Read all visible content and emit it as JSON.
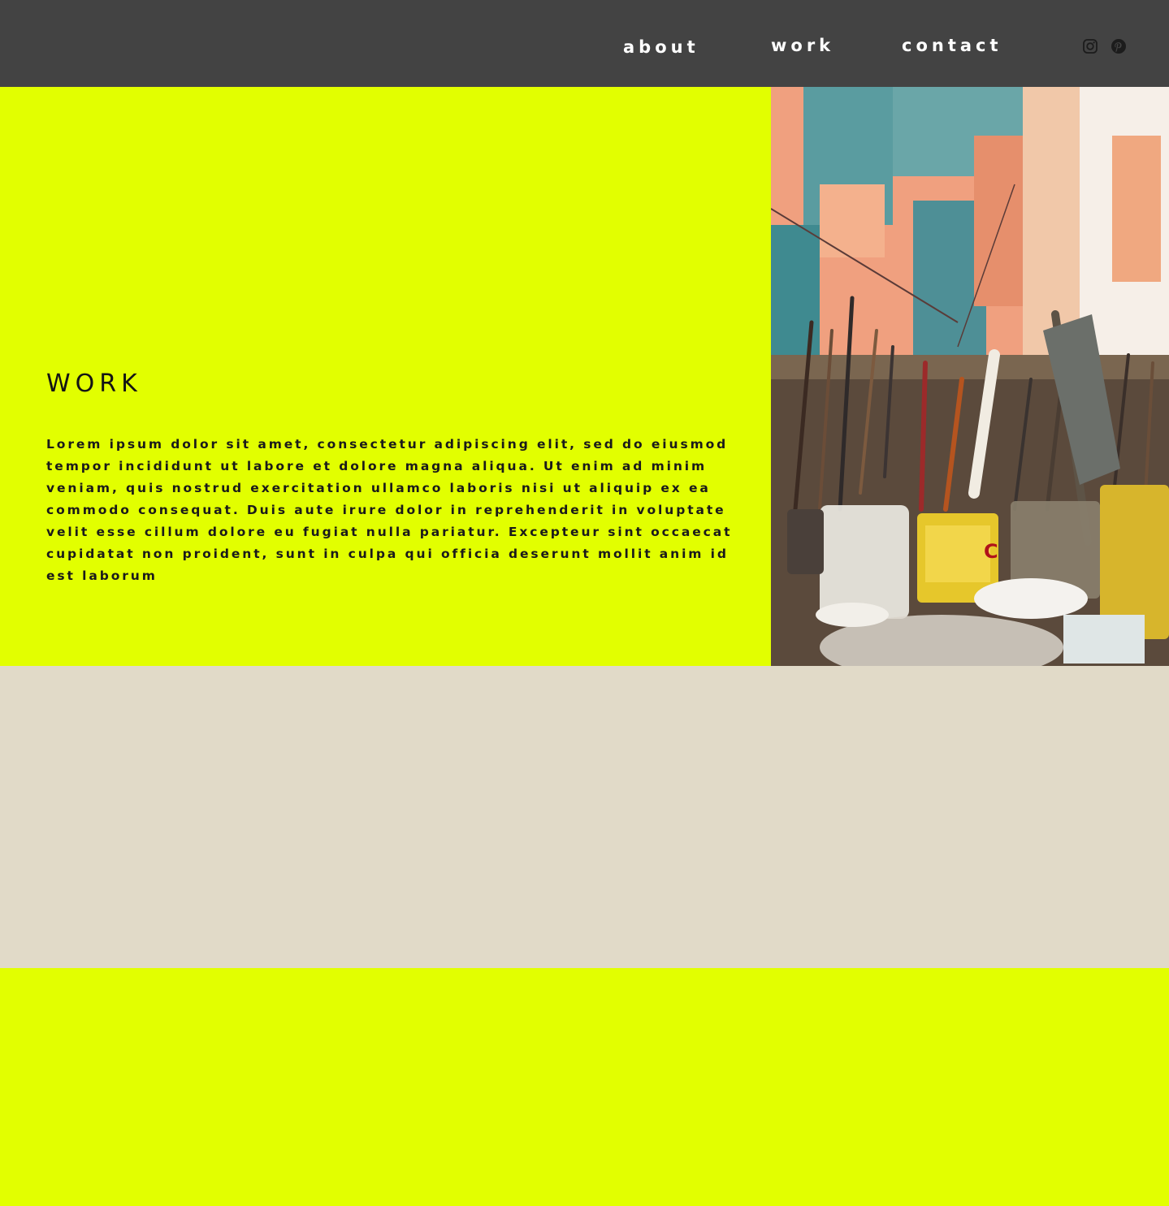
{
  "nav": {
    "links": [
      {
        "label": "about"
      },
      {
        "label": "work"
      },
      {
        "label": "contact"
      }
    ],
    "social": [
      {
        "icon": "instagram-icon"
      },
      {
        "icon": "pinterest-icon"
      }
    ]
  },
  "hero": {
    "title": "WORK",
    "body": "Lorem ipsum dolor sit amet, consectetur adipiscing elit, sed do eiusmod tempor incididunt ut labore et dolore magna aliqua. Ut enim ad minim veniam, quis nostrud exercitation ullamco laboris nisi ut aliquip ex ea commodo consequat. Duis aute irure dolor in reprehenderit in voluptate velit esse cillum dolore eu fugiat nulla pariatur. Excepteur sint occaecat cupidatat non proident, sunt in culpa qui officia deserunt mollit anim id est laborum"
  },
  "colors": {
    "header_bg": "#434343",
    "accent_lime": "#e2ff00",
    "beige": "#e1dac8",
    "text_dark": "#1a1a1a"
  }
}
